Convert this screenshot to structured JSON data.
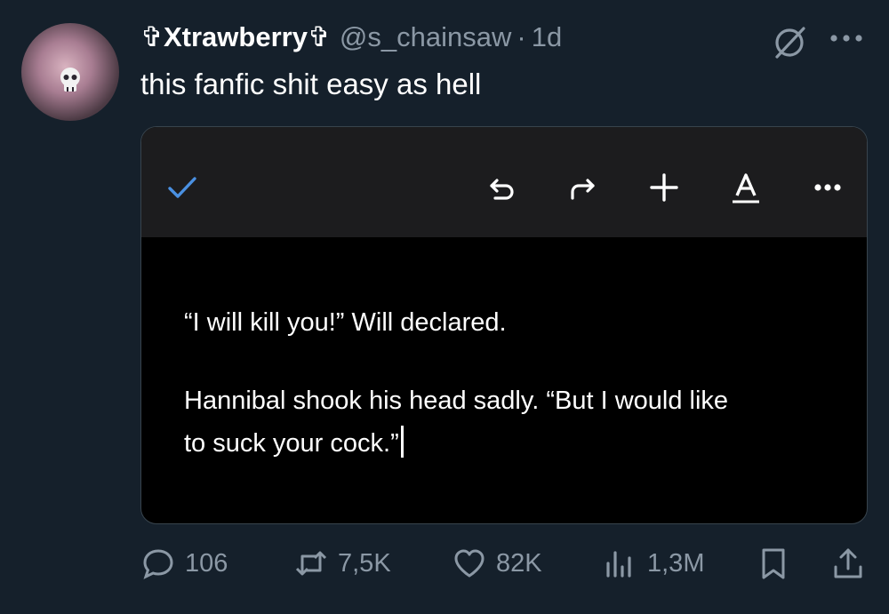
{
  "tweet": {
    "display_name": "✞Xtrawberry✞",
    "handle": "@s_chainsaw",
    "separator": "·",
    "time": "1d",
    "text": "this fanfic shit easy as hell"
  },
  "media": {
    "toolbar_icons": [
      "check-icon",
      "undo-icon",
      "redo-icon",
      "plus-icon",
      "text-format-icon",
      "more-icon"
    ],
    "lines": [
      "“I will kill you!” Will declared.",
      "Hannibal shook his head sadly. “But I would like",
      "to suck your cock.”"
    ]
  },
  "actions": {
    "replies": "106",
    "reposts": "7,5K",
    "likes": "82K",
    "views": "1,3M"
  },
  "colors": {
    "background": "#15202b",
    "secondary_text": "#8b98a5",
    "accent_check": "#4a90e2",
    "toolbar_bg": "#1c1c1e"
  }
}
